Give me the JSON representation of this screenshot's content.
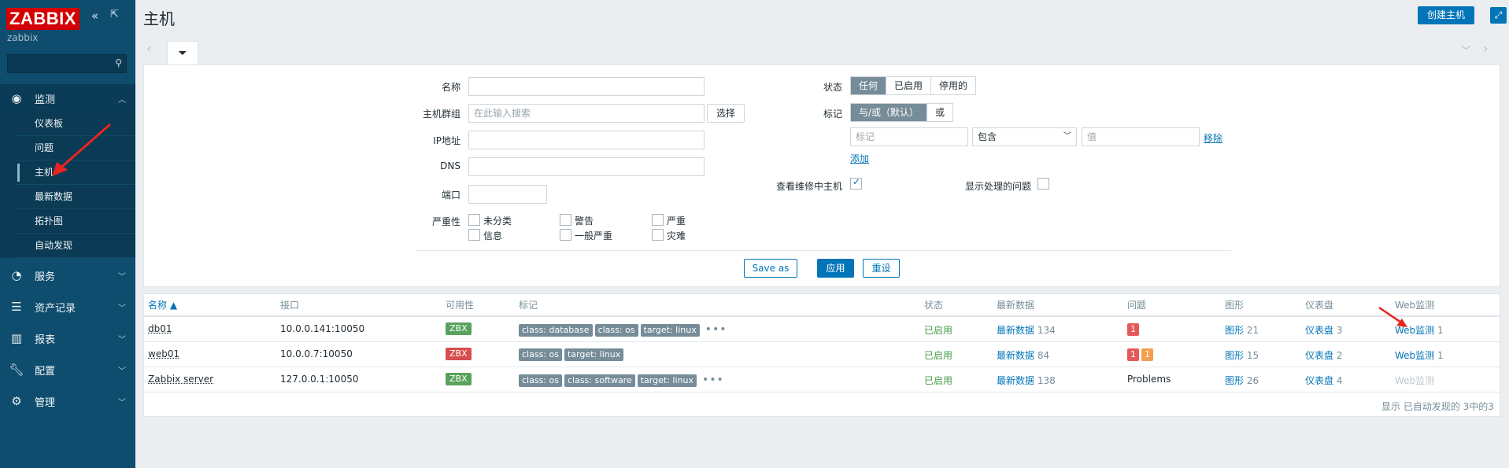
{
  "sidebar": {
    "logo": "ZABBIX",
    "server": "zabbix",
    "sections": [
      {
        "label": "监测",
        "icon": "eye-icon"
      },
      {
        "label": "服务",
        "icon": "clock-icon"
      },
      {
        "label": "资产记录",
        "icon": "list-icon"
      },
      {
        "label": "报表",
        "icon": "bar-chart-icon"
      },
      {
        "label": "配置",
        "icon": "wrench-icon"
      },
      {
        "label": "管理",
        "icon": "gear-icon"
      }
    ],
    "monitoring_items": [
      "仪表板",
      "问题",
      "主机",
      "最新数据",
      "拓扑图",
      "自动发现"
    ]
  },
  "header": {
    "title": "主机",
    "create_button": "创建主机"
  },
  "filter": {
    "name_label": "名称",
    "name_value": "",
    "hostgroup_label": "主机群组",
    "hostgroup_placeholder": "在此输入搜索",
    "select_button": "选择",
    "ip_label": "IP地址",
    "dns_label": "DNS",
    "port_label": "端口",
    "severity_label": "严重性",
    "severities": [
      "未分类",
      "警告",
      "严重",
      "信息",
      "一般严重",
      "灾难"
    ],
    "status_label": "状态",
    "status_options": [
      "任何",
      "已启用",
      "停用的"
    ],
    "tags_label": "标记",
    "tag_mode_options": [
      "与/或（默认）",
      "或"
    ],
    "tag_placeholder": "标记",
    "tag_operator": "包含",
    "tag_value_placeholder": "值",
    "remove_link": "移除",
    "add_link": "添加",
    "maintenance_label": "查看维修中主机",
    "suppressed_label": "显示处理的问题",
    "save_as": "Save as",
    "apply": "应用",
    "reset": "重设"
  },
  "table": {
    "headers": [
      "名称 ▲",
      "接口",
      "可用性",
      "标记",
      "状态",
      "最新数据",
      "问题",
      "图形",
      "仪表盘",
      "Web监测"
    ],
    "rows": [
      {
        "name": "db01",
        "interface": "10.0.0.141:10050",
        "availability": "ZBX",
        "avail_color": "#59a25d",
        "tags": [
          "class: database",
          "class: os",
          "target: linux"
        ],
        "more": "•••",
        "status": "已启用",
        "latest_label": "最新数据",
        "latest_count": "134",
        "problems": [
          "1"
        ],
        "problem_colors": [
          "#e45959"
        ],
        "graphs_label": "图形",
        "graphs_count": "21",
        "dash_label": "仪表盘",
        "dash_count": "3",
        "web_label": "Web监测",
        "web_count": "1"
      },
      {
        "name": "web01",
        "interface": "10.0.0.7:10050",
        "availability": "ZBX",
        "avail_color": "#d64e4e",
        "tags": [
          "class: os",
          "target: linux"
        ],
        "more": "",
        "status": "已启用",
        "latest_label": "最新数据",
        "latest_count": "84",
        "problems": [
          "1",
          "1"
        ],
        "problem_colors": [
          "#e45959",
          "#f79d4f"
        ],
        "graphs_label": "图形",
        "graphs_count": "15",
        "dash_label": "仪表盘",
        "dash_count": "2",
        "web_label": "Web监测",
        "web_count": "1"
      },
      {
        "name": "Zabbix server",
        "interface": "127.0.0.1:10050",
        "availability": "ZBX",
        "avail_color": "#59a25d",
        "tags": [
          "class: os",
          "class: software",
          "target: linux"
        ],
        "more": "•••",
        "status": "已启用",
        "latest_label": "最新数据",
        "latest_count": "138",
        "problems_text": "Problems",
        "graphs_label": "图形",
        "graphs_count": "26",
        "dash_label": "仪表盘",
        "dash_count": "4",
        "web_label": "Web监测",
        "web_count": ""
      }
    ],
    "footer": "显示 已自动发现的 3中的3"
  }
}
